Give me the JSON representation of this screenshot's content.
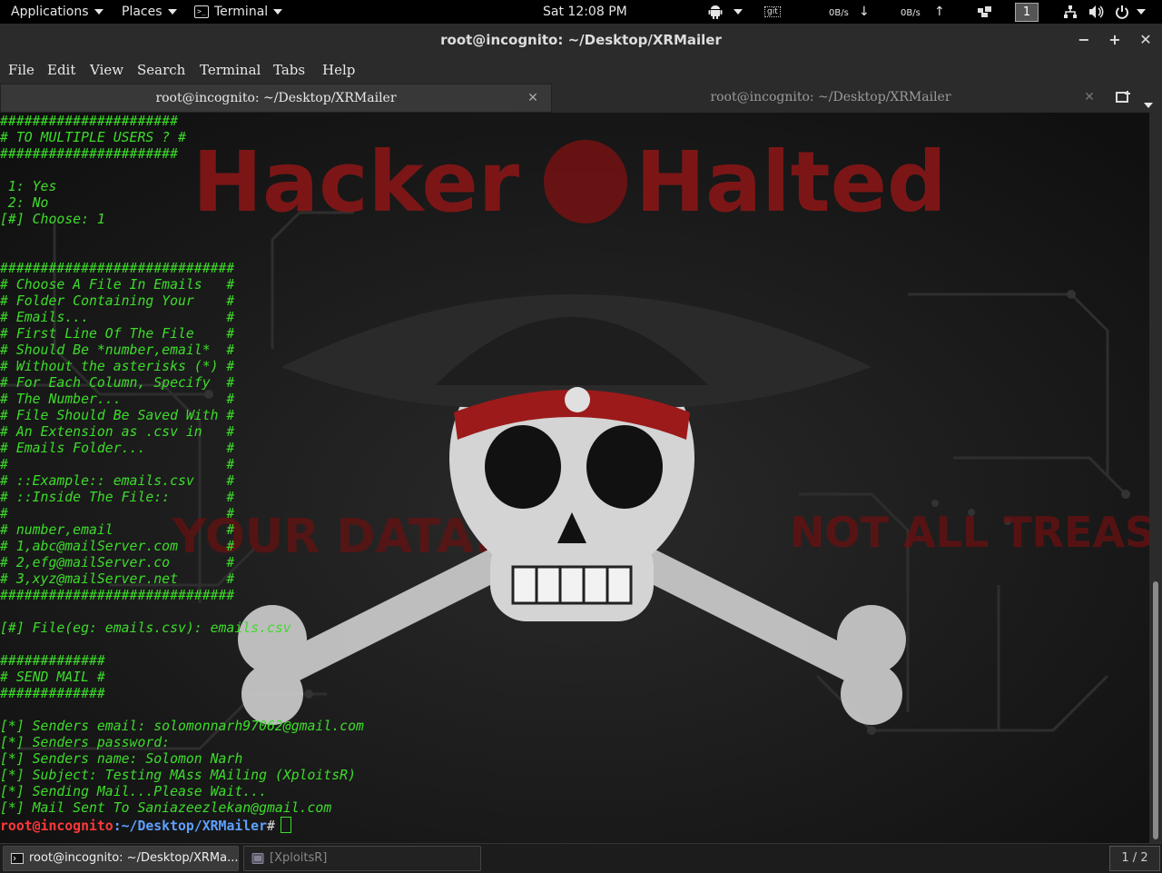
{
  "top_panel": {
    "applications_label": "Applications",
    "places_label": "Places",
    "terminal_label": "Terminal",
    "clock": "Sat 12:08 PM",
    "git_label": "git",
    "download_rate": "0B/s",
    "upload_rate": "0B/s",
    "workspace_number": "1"
  },
  "window": {
    "title": "root@incognito: ~/Desktop/XRMailer",
    "minimize": "−",
    "maximize": "+",
    "close": "✕"
  },
  "menu": {
    "items": [
      "File",
      "Edit",
      "View",
      "Search",
      "Terminal",
      "Tabs",
      "Help"
    ]
  },
  "tabs": [
    {
      "label": "root@incognito: ~/Desktop/XRMailer",
      "active": true
    },
    {
      "label": "root@incognito: ~/Desktop/XRMailer",
      "active": false
    }
  ],
  "terminal": {
    "lines": [
      "######################",
      "# TO MULTIPLE USERS ? #",
      "######################",
      "",
      " 1: Yes",
      " 2: No",
      "[#] Choose: 1",
      "",
      "",
      "#############################",
      "# Choose A File In Emails   #",
      "# Folder Containing Your    #",
      "# Emails...                 #",
      "# First Line Of The File    #",
      "# Should Be *number,email*  #",
      "# Without the asterisks (*) #",
      "# For Each Column, Specify  #",
      "# The Number...             #",
      "# File Should Be Saved With #",
      "# An Extension as .csv in   #",
      "# Emails Folder...          #",
      "#                           #",
      "# ::Example:: emails.csv    #",
      "# ::Inside The File::       #",
      "#                           #",
      "# number,email              #",
      "# 1,abc@mailServer.com      #",
      "# 2,efg@mailServer.co       #",
      "# 3,xyz@mailServer.net      #",
      "#############################",
      "",
      "[#] File(eg: emails.csv): emails.csv",
      "",
      "#############",
      "# SEND MAIL #",
      "#############",
      "",
      "[*] Senders email: solomonnarh97062@gmail.com",
      "[*] Senders password:",
      "[*] Senders name: Solomon Narh",
      "[*] Subject: Testing MAss MAiling (XploitsR)",
      "[*] Sending Mail...Please Wait...",
      "[*] Mail Sent To Saniazeezlekan@gmail.com"
    ],
    "prompt_user": "root@incognito",
    "prompt_colon": ":",
    "prompt_path": "~/Desktop/XRMailer",
    "prompt_symbol": "#"
  },
  "wallpaper": {
    "headline_left": "Hacker",
    "headline_right": "Halted",
    "text_left": "YOUR DATA...",
    "text_right": "NOT ALL TREAS"
  },
  "taskbar": {
    "items": [
      {
        "label": "root@incognito: ~/Desktop/XRMa...",
        "active": true
      },
      {
        "label": "[XploitsR]",
        "active": false
      }
    ],
    "pager": "1 / 2"
  },
  "colors": {
    "terminal_text": "#3ddc2b",
    "prompt_user": "#ff3838",
    "prompt_path": "#5ea0ff",
    "wallpaper_red": "#a01818"
  }
}
